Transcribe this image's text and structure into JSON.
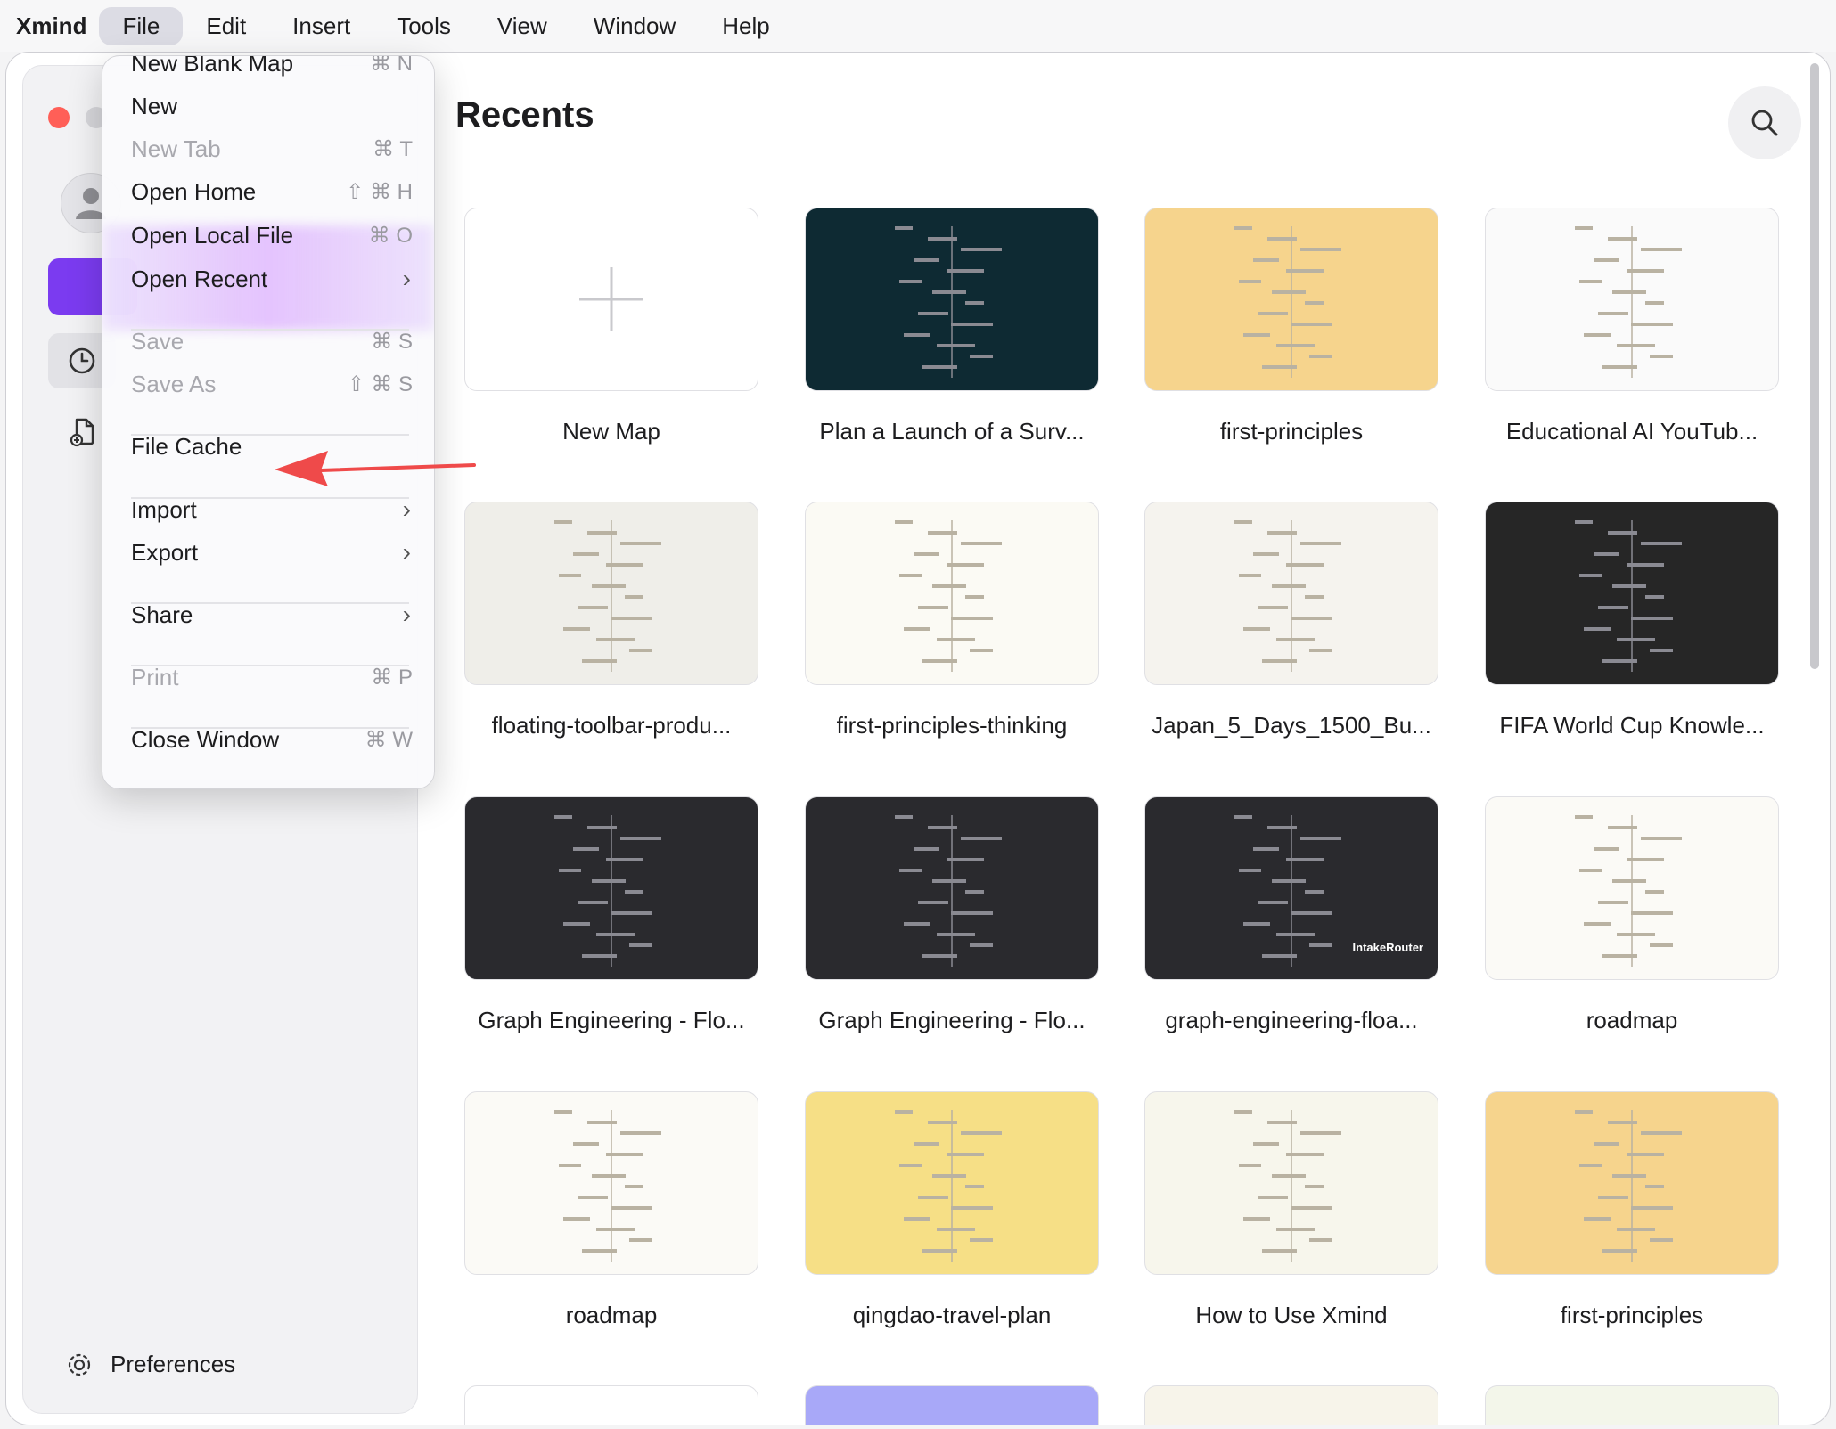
{
  "menubar": {
    "app": "Xmind",
    "items": [
      "File",
      "Edit",
      "Insert",
      "Tools",
      "View",
      "Window",
      "Help"
    ]
  },
  "main": {
    "title": "Recents"
  },
  "sidebar": {
    "preferences": "Preferences"
  },
  "file_menu": {
    "items": [
      {
        "label": "New Blank Map",
        "shortcut": "⌘ N"
      },
      {
        "label": "New",
        "shortcut": ""
      },
      {
        "label": "New Tab",
        "shortcut": "⌘ T"
      },
      {
        "label": "Open Home",
        "shortcut": "⇧ ⌘ H"
      },
      {
        "label": "Open Local File",
        "shortcut": "⌘ O"
      },
      {
        "label": "Open Recent",
        "shortcut": "›"
      },
      {
        "label": "Save",
        "shortcut": "⌘ S"
      },
      {
        "label": "Save As",
        "shortcut": "⇧ ⌘ S"
      },
      {
        "label": "File Cache",
        "shortcut": ""
      },
      {
        "label": "Import",
        "shortcut": "›"
      },
      {
        "label": "Export",
        "shortcut": "›"
      },
      {
        "label": "Share",
        "shortcut": "›"
      },
      {
        "label": "Print",
        "shortcut": "⌘ P"
      },
      {
        "label": "Close Window",
        "shortcut": "⌘ W"
      }
    ]
  },
  "recents": [
    {
      "name": "New Map",
      "bg": "#ffffff"
    },
    {
      "name": "Plan a Launch of a Surv...",
      "bg": "#0e2a33"
    },
    {
      "name": "first-principles",
      "bg": "#f6d48d"
    },
    {
      "name": "Educational AI YouTub...",
      "bg": "#fafafa"
    },
    {
      "name": "floating-toolbar-produ...",
      "bg": "#efeee9"
    },
    {
      "name": "first-principles-thinking",
      "bg": "#fbfaf4"
    },
    {
      "name": "Japan_5_Days_1500_Bu...",
      "bg": "#f5f3ee"
    },
    {
      "name": "FIFA World Cup Knowle...",
      "bg": "#262626"
    },
    {
      "name": "Graph Engineering - Flo...",
      "bg": "#2a2a2e"
    },
    {
      "name": "Graph Engineering - Flo...",
      "bg": "#2a2a2e"
    },
    {
      "name": "graph-engineering-floa...",
      "bg": "#2a2a2e"
    },
    {
      "name": "roadmap",
      "bg": "#fbfaf6"
    },
    {
      "name": "roadmap",
      "bg": "#fbfaf6"
    },
    {
      "name": "qingdao-travel-plan",
      "bg": "#f6df86"
    },
    {
      "name": "How to Use Xmind",
      "bg": "#f7f6ec"
    },
    {
      "name": "first-principles",
      "bg": "#f6d48d"
    }
  ],
  "partial_row_colors": [
    "#ffffff",
    "#a8a8f8",
    "#f7f4ea",
    "#f3f6ea"
  ],
  "thumb_text": {
    "intake": "IntakeRouter"
  },
  "colors": {
    "accent": "#7b3bf0",
    "close": "#ff5f57",
    "arrow": "#ef4a4a"
  }
}
